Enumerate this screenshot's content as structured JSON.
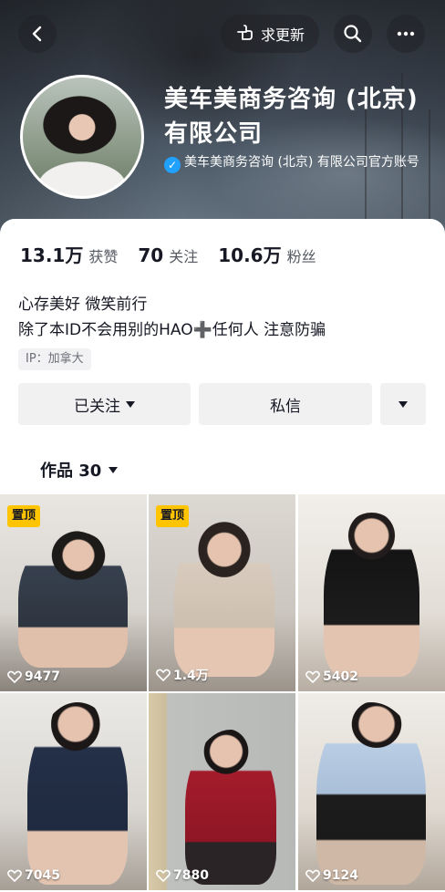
{
  "header": {
    "back_icon": "chevron-left-icon",
    "update_label": "求更新",
    "update_icon": "pointing-hand-icon",
    "search_icon": "search-icon",
    "more_icon": "more-dots-icon"
  },
  "profile": {
    "name": "美车美商务咨询 (北京) 有限公司",
    "verified_text": "美车美商务咨询 (北京) 有限公司官方账号"
  },
  "stats": {
    "likes_num": "13.1万",
    "likes_label": "获赞",
    "following_num": "70",
    "following_label": "关注",
    "followers_num": "10.6万",
    "followers_label": "粉丝"
  },
  "bio": {
    "line1": "心存美好 微笑前行",
    "line2": "除了本ID不会用别的HAO➕任何人 注意防骗",
    "ip": "IP：加拿大"
  },
  "actions": {
    "followed_label": "已关注",
    "message_label": "私信"
  },
  "works_tab": {
    "label": "作品 30"
  },
  "videos": [
    {
      "pinned": "置顶",
      "likes": "9477"
    },
    {
      "pinned": "置顶",
      "likes": "1.4万"
    },
    {
      "pinned": "",
      "likes": "5402"
    },
    {
      "pinned": "",
      "likes": "7045"
    },
    {
      "pinned": "",
      "likes": "7880"
    },
    {
      "pinned": "",
      "likes": "9124"
    }
  ],
  "colors": {
    "pin_badge": "#ffc400",
    "verified": "#20a0ff"
  }
}
